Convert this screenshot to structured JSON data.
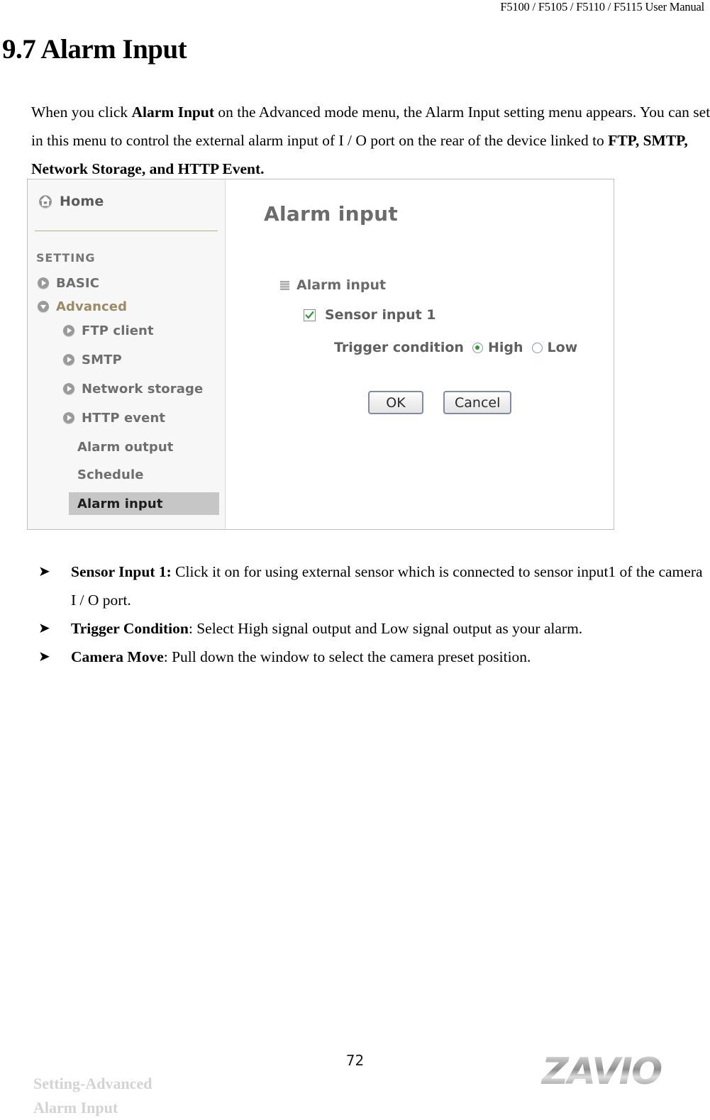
{
  "header": {
    "running_title": "F5100 / F5105 / F5110 / F5115 User Manual"
  },
  "heading": {
    "title": "9.7 Alarm Input"
  },
  "intro": {
    "part1": "When you click ",
    "bold1": "Alarm Input",
    "part2": " on the Advanced mode menu, the Alarm Input setting menu appears. You can set in this menu to control the external alarm input of I / O port on the rear of the device linked to ",
    "bold2": "FTP, SMTP, Network Storage, and HTTP Event."
  },
  "screenshot": {
    "sidebar": {
      "home": {
        "label": "Home",
        "icon": "home-icon"
      },
      "section_label": "SETTING",
      "items": [
        {
          "label": "BASIC",
          "icon": "arrow-right-icon",
          "level": 1,
          "state": "collapsed"
        },
        {
          "label": "Advanced",
          "icon": "arrow-down-icon",
          "level": 1,
          "state": "expanded"
        },
        {
          "label": "FTP client",
          "icon": "arrow-right-icon",
          "level": 2,
          "state": "collapsed"
        },
        {
          "label": "SMTP",
          "icon": "arrow-right-icon",
          "level": 2,
          "state": "collapsed"
        },
        {
          "label": "Network storage",
          "icon": "arrow-right-icon",
          "level": 2,
          "state": "collapsed"
        },
        {
          "label": "HTTP event",
          "icon": "arrow-right-icon",
          "level": 2,
          "state": "collapsed"
        },
        {
          "label": "Alarm output",
          "icon": "none",
          "level": 2,
          "state": "leaf"
        },
        {
          "label": "Schedule",
          "icon": "none",
          "level": 2,
          "state": "leaf"
        },
        {
          "label": "Alarm input",
          "icon": "none",
          "level": 2,
          "state": "selected"
        }
      ]
    },
    "main": {
      "title": "Alarm input",
      "group_label": "Alarm input",
      "sensor": {
        "label": "Sensor input 1",
        "checked": true
      },
      "trigger": {
        "label": "Trigger condition",
        "options": [
          {
            "label": "High",
            "selected": true
          },
          {
            "label": "Low",
            "selected": false
          }
        ]
      },
      "buttons": {
        "ok": "OK",
        "cancel": "Cancel"
      }
    },
    "colors": {
      "sidebar_bg": "#f7f7f7",
      "selected_bg": "#c6c6c6",
      "accent_text": "#9b8a63",
      "check_green": "#2e9b34",
      "radio_ring": "#8796ad"
    }
  },
  "bullets": [
    {
      "marker": "➤",
      "bold": "Sensor Input 1:",
      "text": " Click it on for using external sensor which is connected to sensor input1 of the camera I / O port."
    },
    {
      "marker": "➤",
      "bold": "Trigger Condition",
      "text": ": Select High signal output and Low signal output as your alarm."
    },
    {
      "marker": "➤",
      "bold": "Camera Move",
      "text": ": Pull down the window to select the camera preset position."
    }
  ],
  "footer": {
    "note": "Setting-Advanced\nAlarm Input",
    "page_number": "72",
    "logo_text": "ZAVIO"
  }
}
